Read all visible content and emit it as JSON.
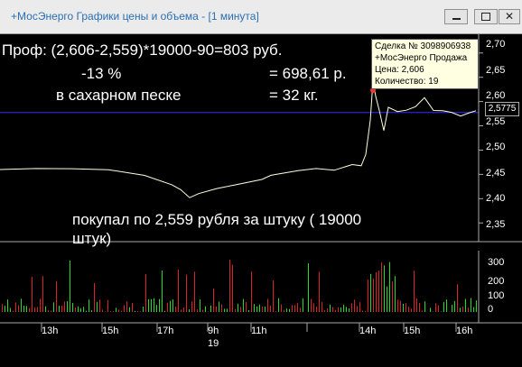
{
  "window": {
    "title": "+МосЭнерго Графики цены и объема - [1 минута]"
  },
  "annotation": {
    "line1": "Проф:  (2,606-2,559)*19000-90=803 руб.",
    "line2_left": "-13 %",
    "line2_right": "= 698,61 р.",
    "line3_left": "в сахарном песке",
    "line3_right": "= 32 кг.",
    "buy_note_line1": "покупал по 2,559 рубля за штуку ( 19000",
    "buy_note_line2": "штук)"
  },
  "tooltip": {
    "line1": "Сделка № 3098906938",
    "line2": "+МосЭнерго Продажа",
    "line3": "Цена: 2,606",
    "line4": "Количество: 19"
  },
  "price_axis": {
    "ticks": [
      "2,70",
      "2,65",
      "2,60",
      "2,55",
      "2,50",
      "2,45",
      "2,40",
      "2,35"
    ],
    "current": "2,5775"
  },
  "volume_axis": {
    "ticks": [
      "300",
      "200",
      "100",
      "0"
    ]
  },
  "time_axis": {
    "ticks": [
      "13h",
      "15h",
      "17h",
      "9h",
      "11h",
      "14h",
      "15h",
      "16h"
    ],
    "date": "19"
  },
  "colors": {
    "price_line": "#ffffe0",
    "volume_up": "#22dd22",
    "volume_down": "#dd2222",
    "current_price_line": "#2f2fff",
    "tooltip_bg": "#ffffe1",
    "title_text": "#2b6fb3"
  },
  "chart_data": {
    "type": "line",
    "y_axis": {
      "min": 2.33,
      "max": 2.72
    },
    "price_series": [
      [
        0,
        2.46
      ],
      [
        40,
        2.46
      ],
      [
        80,
        2.46
      ],
      [
        120,
        2.46
      ],
      [
        160,
        2.45
      ],
      [
        190,
        2.43
      ],
      [
        200,
        2.42
      ],
      [
        210,
        2.4
      ],
      [
        220,
        2.41
      ],
      [
        240,
        2.42
      ],
      [
        260,
        2.43
      ],
      [
        290,
        2.44
      ],
      [
        300,
        2.45
      ],
      [
        330,
        2.46
      ],
      [
        350,
        2.46
      ],
      [
        370,
        2.46
      ],
      [
        390,
        2.47
      ],
      [
        400,
        2.47
      ],
      [
        405,
        2.49
      ],
      [
        410,
        2.56
      ],
      [
        413,
        2.64
      ],
      [
        416,
        2.61
      ],
      [
        420,
        2.58
      ],
      [
        425,
        2.54
      ],
      [
        430,
        2.59
      ],
      [
        440,
        2.58
      ],
      [
        450,
        2.58
      ],
      [
        460,
        2.59
      ],
      [
        470,
        2.61
      ],
      [
        480,
        2.58
      ],
      [
        490,
        2.58
      ],
      [
        500,
        2.58
      ],
      [
        510,
        2.57
      ],
      [
        520,
        2.575
      ],
      [
        527,
        2.58
      ]
    ],
    "current_price": 2.5775,
    "volume_range": [
      0,
      350
    ]
  }
}
